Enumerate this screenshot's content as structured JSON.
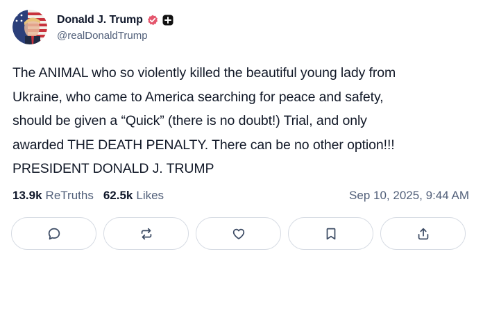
{
  "post": {
    "author": {
      "display_name": "Donald J. Trump",
      "handle": "@realDonaldTrump",
      "verified_icon": "verified-badge-icon",
      "plus_icon": "plus-badge-icon"
    },
    "text_lines": [
      "The ANIMAL who so violently killed the beautiful young lady from",
      "Ukraine, who came to America searching for peace and safety,",
      "should be given a “Quick” (there is no doubt!) Trial, and only",
      "awarded THE DEATH PENALTY. There can be no other option!!!",
      "PRESIDENT DONALD J. TRUMP"
    ],
    "stats": {
      "retruths_count": "13.9k",
      "retruths_label": "ReTruths",
      "likes_count": "62.5k",
      "likes_label": "Likes"
    },
    "timestamp": "Sep 10, 2025, 9:44 AM"
  },
  "actions": [
    {
      "name": "reply",
      "icon": "comment-icon"
    },
    {
      "name": "retruth",
      "icon": "repost-icon"
    },
    {
      "name": "like",
      "icon": "heart-icon"
    },
    {
      "name": "bookmark",
      "icon": "bookmark-icon"
    },
    {
      "name": "share",
      "icon": "share-icon"
    }
  ],
  "colors": {
    "verified": "#e4566d",
    "text": "#111827",
    "muted": "#52607a",
    "border": "#d6dbe3"
  }
}
